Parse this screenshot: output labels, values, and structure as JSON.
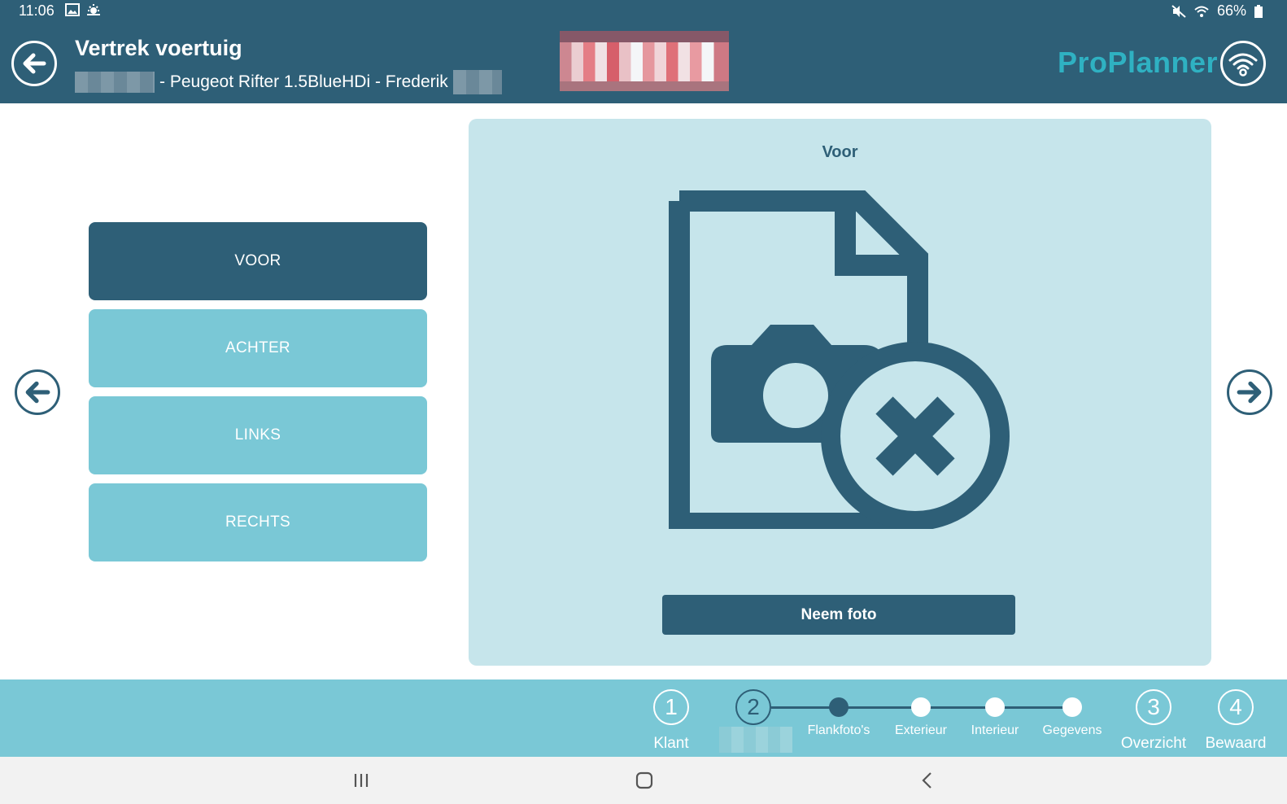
{
  "status_bar": {
    "time": "11:06",
    "battery": "66%"
  },
  "header": {
    "title": "Vertrek voertuig",
    "subtitle": "- Peugeot Rifter 1.5BlueHDi - Frederik",
    "brand": "ProPlanner"
  },
  "sides": {
    "items": [
      {
        "label": "VOOR",
        "active": true
      },
      {
        "label": "ACHTER",
        "active": false
      },
      {
        "label": "LINKS",
        "active": false
      },
      {
        "label": "RECHTS",
        "active": false
      }
    ]
  },
  "panel": {
    "title": "Voor",
    "photo_button": "Neem foto",
    "illustration_icon": "no-photo-icon"
  },
  "stepper": {
    "steps": [
      {
        "number": "1",
        "label": "Klant"
      },
      {
        "number": "2",
        "label": ""
      },
      {
        "number": "3",
        "label": "Overzicht"
      },
      {
        "number": "4",
        "label": "Bewaard"
      }
    ],
    "substeps": [
      {
        "label": "Flankfoto's",
        "active": true
      },
      {
        "label": "Exterieur",
        "active": false
      },
      {
        "label": "Interieur",
        "active": false
      },
      {
        "label": "Gegevens",
        "active": false
      }
    ]
  },
  "colors": {
    "primary": "#2e5f77",
    "accent": "#7ac8d6",
    "panel": "#c6e5eb",
    "brand": "#2fb1c2"
  }
}
